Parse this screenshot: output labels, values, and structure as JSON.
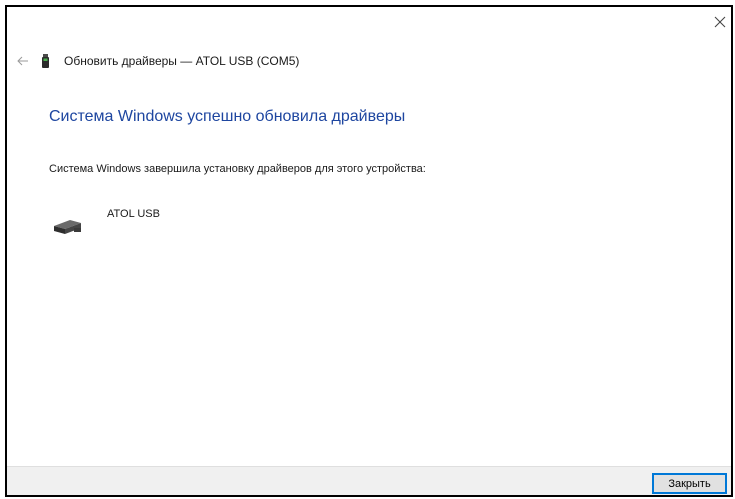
{
  "window": {
    "title": "Обновить драйверы — ATOL USB (COM5)",
    "close_glyph": "×",
    "back_glyph": "←"
  },
  "main": {
    "heading": "Система Windows успешно обновила драйверы",
    "description": "Система Windows завершила установку драйверов для этого устройства:",
    "device_name": "ATOL USB"
  },
  "footer": {
    "close_label": "Закрыть"
  },
  "colors": {
    "heading": "#1e46a0",
    "footer_bg": "#f0f0f0",
    "button_border": "#0078d7"
  },
  "icons": {
    "title": "usb-device-icon",
    "device": "usb-device-icon",
    "back": "back-arrow-icon",
    "close": "close-icon"
  }
}
